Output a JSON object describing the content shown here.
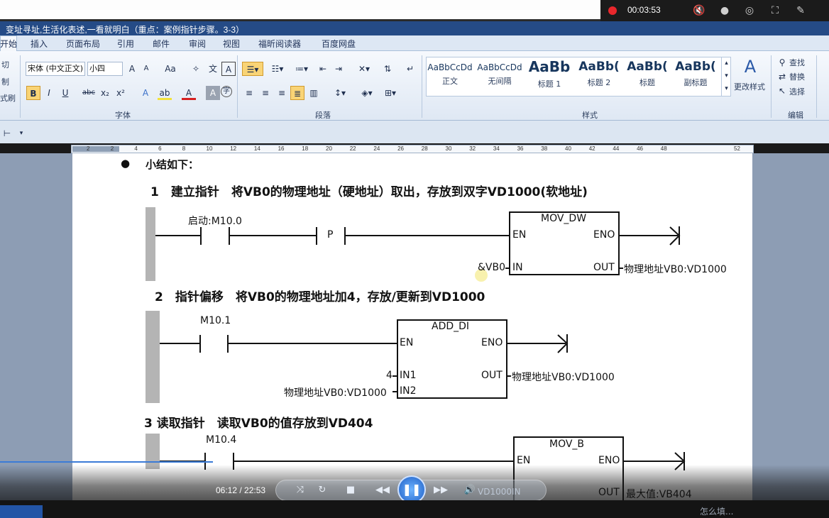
{
  "recorder": {
    "time": "00:03:53",
    "icons": [
      "mute-icon",
      "microphone-icon",
      "camera-icon",
      "crop-icon",
      "pen-icon"
    ]
  },
  "word": {
    "title": "变址寻址,生活化表述,一看就明白（重点：案例指针步骤。3-3）",
    "tabs": [
      "开始",
      "插入",
      "页面布局",
      "引用",
      "邮件",
      "审阅",
      "视图",
      "福昕阅读器",
      "百度网盘"
    ],
    "clipboard": [
      "切",
      "制",
      "式刷"
    ],
    "font_name": "宋体 (中文正文)",
    "font_size": "小四",
    "group_font": "字体",
    "group_paragraph": "段落",
    "group_styles": "样式",
    "group_edit": "编辑",
    "styles": [
      {
        "sample": "AaBbCcDd",
        "name": "正文"
      },
      {
        "sample": "AaBbCcDd",
        "name": "无间隔"
      },
      {
        "sample": "AaBb",
        "name": "标题 1"
      },
      {
        "sample": "AaBb(",
        "name": "标题 2"
      },
      {
        "sample": "AaBb(",
        "name": "标题"
      },
      {
        "sample": "AaBb(",
        "name": "副标题"
      }
    ],
    "change_styles": "更改样式",
    "find": "查找",
    "replace": "替换",
    "select": "选择",
    "ruler_numbers": [
      "2",
      "2",
      "4",
      "6",
      "8",
      "10",
      "12",
      "14",
      "16",
      "18",
      "20",
      "22",
      "24",
      "26",
      "28",
      "30",
      "32",
      "34",
      "36",
      "38",
      "40",
      "42",
      "44",
      "46",
      "48",
      "52"
    ]
  },
  "document": {
    "summary": "小结如下：",
    "step1": "1　建立指针　将VB0的物理地址（硬地址）取出，存放到双字VD1000(软地址)",
    "step2": "2　指针偏移　将VB0的物理地址加4，存放/更新到VD1000",
    "step3": "3 读取指针　读取VB0的值存放到VD404",
    "ladder1": {
      "contact_label": "启动:M10.0",
      "p_label": "P",
      "box_title": "MOV_DW",
      "en": "EN",
      "eno": "ENO",
      "in": "IN",
      "out": "OUT",
      "in_value": "&VB0",
      "out_value": "物理地址VB0:VD1000"
    },
    "ladder2": {
      "contact_label": "M10.1",
      "box_title": "ADD_DI",
      "en": "EN",
      "eno": "ENO",
      "in1": "IN1",
      "in2": "IN2",
      "out": "OUT",
      "in1_value": "4",
      "in2_value": "物理地址VB0:VD1000",
      "out_value": "物理地址VB0:VD1000"
    },
    "ladder3": {
      "contact_label": "M10.4",
      "box_title": "MOV_B",
      "en": "EN",
      "eno": "ENO",
      "in": "IN",
      "out": "OUT",
      "in_value": "VD1000",
      "out_value": "最大值:VB404"
    }
  },
  "player": {
    "time": "06:12 / 22:53",
    "taskbar_hint": "怎么填..."
  }
}
